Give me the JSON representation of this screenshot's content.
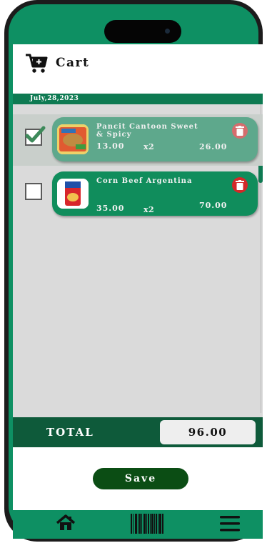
{
  "header": {
    "title": "Cart",
    "icon": "cart-icon"
  },
  "date": "July,28,2023",
  "items": [
    {
      "name": "Pancit Cantoon Sweet & Spicy",
      "price": "13.00",
      "qty": "x2",
      "subtotal": "26.00",
      "checked": true,
      "image": "pancit-canton-pack-image"
    },
    {
      "name": "Corn Beef Argentina",
      "price": "35.00",
      "qty": "x2",
      "subtotal": "70.00",
      "checked": false,
      "image": "corned-beef-can-image"
    }
  ],
  "total": {
    "label": "TOTAL",
    "value": "96.00"
  },
  "save_label": "Save",
  "nav": {
    "icons": [
      "home-icon",
      "barcode-icon",
      "menu-icon"
    ]
  },
  "colors": {
    "primary_green": "#0e9063",
    "dark_green": "#0e5a3a",
    "save_button": "#0b4d14",
    "delete_red": "#d32828"
  }
}
